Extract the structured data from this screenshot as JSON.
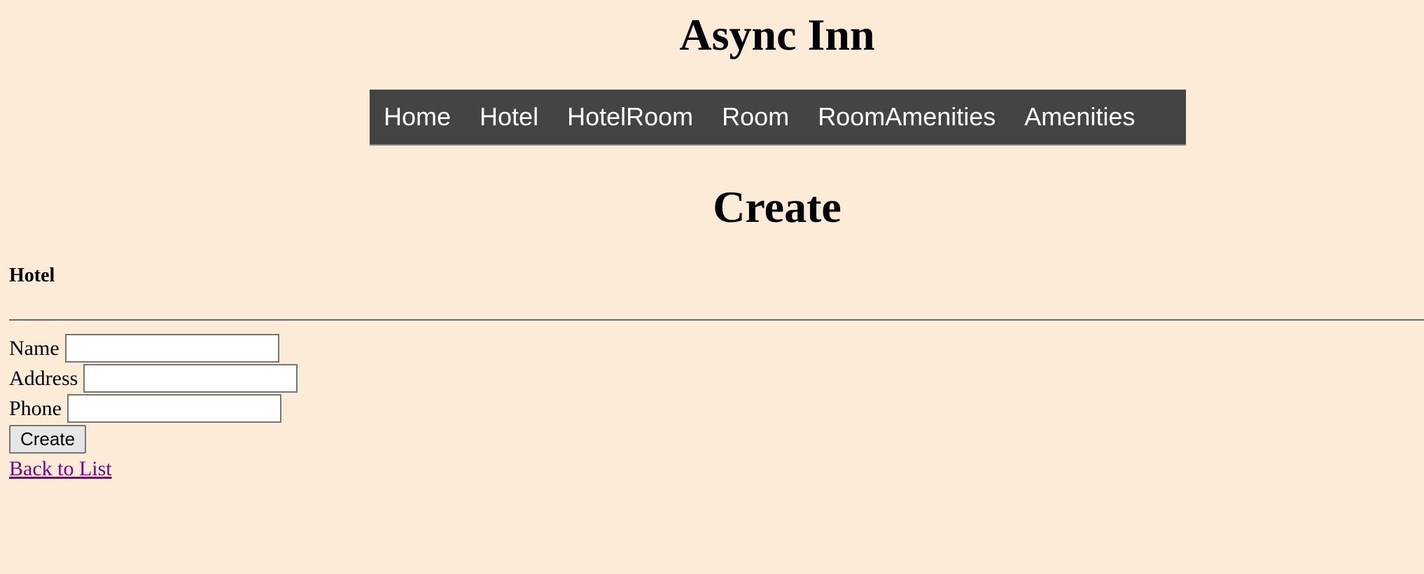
{
  "header": {
    "site_title": "Async Inn"
  },
  "nav": {
    "items": [
      {
        "label": "Home"
      },
      {
        "label": "Hotel"
      },
      {
        "label": "HotelRoom"
      },
      {
        "label": "Room"
      },
      {
        "label": "RoomAmenities"
      },
      {
        "label": "Amenities"
      }
    ]
  },
  "page": {
    "heading": "Create",
    "section_title": "Hotel"
  },
  "form": {
    "name_label": "Name",
    "name_value": "",
    "address_label": "Address",
    "address_value": "",
    "phone_label": "Phone",
    "phone_value": "",
    "submit_label": "Create"
  },
  "links": {
    "back_to_list": "Back to List"
  },
  "colors": {
    "background": "#fbebd7",
    "nav_background": "#444444",
    "nav_text": "#ffffff",
    "visited_link": "#800080"
  }
}
